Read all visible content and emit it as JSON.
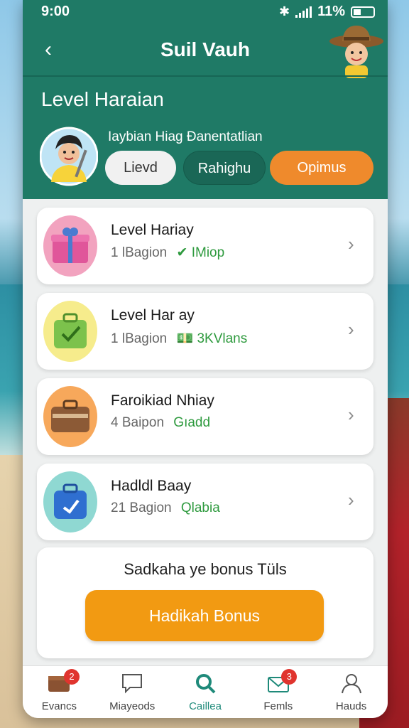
{
  "status_bar": {
    "time": "9:00",
    "battery": "11%"
  },
  "header": {
    "title": "Suil Vauh"
  },
  "level": {
    "title": "Level Haraian",
    "subtitle": "Iaybian Hiag Đanentatlian",
    "pills": [
      "Lievd",
      "Rahighu",
      "Opimus"
    ]
  },
  "cards": [
    {
      "title": "Level Hariay",
      "meta": "1 lBagion",
      "tag": "IMiop",
      "icon": "gift-box-icon"
    },
    {
      "title": "Level Har ay",
      "meta": "1 lBagion",
      "tag": "3KVlans",
      "icon": "luggage-check-icon"
    },
    {
      "title": "Faroikiad Nhiay",
      "meta": "4 Baipon",
      "tag": "Gıadd",
      "icon": "suitcase-icon"
    },
    {
      "title": "Hadldl Baay",
      "meta": "21 Bagion",
      "tag": "Qlabia",
      "icon": "blue-bag-icon"
    }
  ],
  "bonus": {
    "text": "Sadkaha ye bonus Tüls",
    "button": "Hadikah Bonus"
  },
  "tabs": [
    {
      "label": "Evancs",
      "badge": "2",
      "icon": "wallet-icon"
    },
    {
      "label": "Miayeods",
      "badge": "",
      "icon": "chat-icon"
    },
    {
      "label": "Caillea",
      "badge": "",
      "icon": "search-icon",
      "active": true
    },
    {
      "label": "Femls",
      "badge": "3",
      "icon": "mail-icon"
    },
    {
      "label": "Hauds",
      "badge": "",
      "icon": "profile-icon"
    }
  ],
  "colors": {
    "header": "#1f7a66",
    "accent": "#ef8a2c",
    "tag_green": "#2e9a3e",
    "bonus_button": "#f29a12"
  }
}
